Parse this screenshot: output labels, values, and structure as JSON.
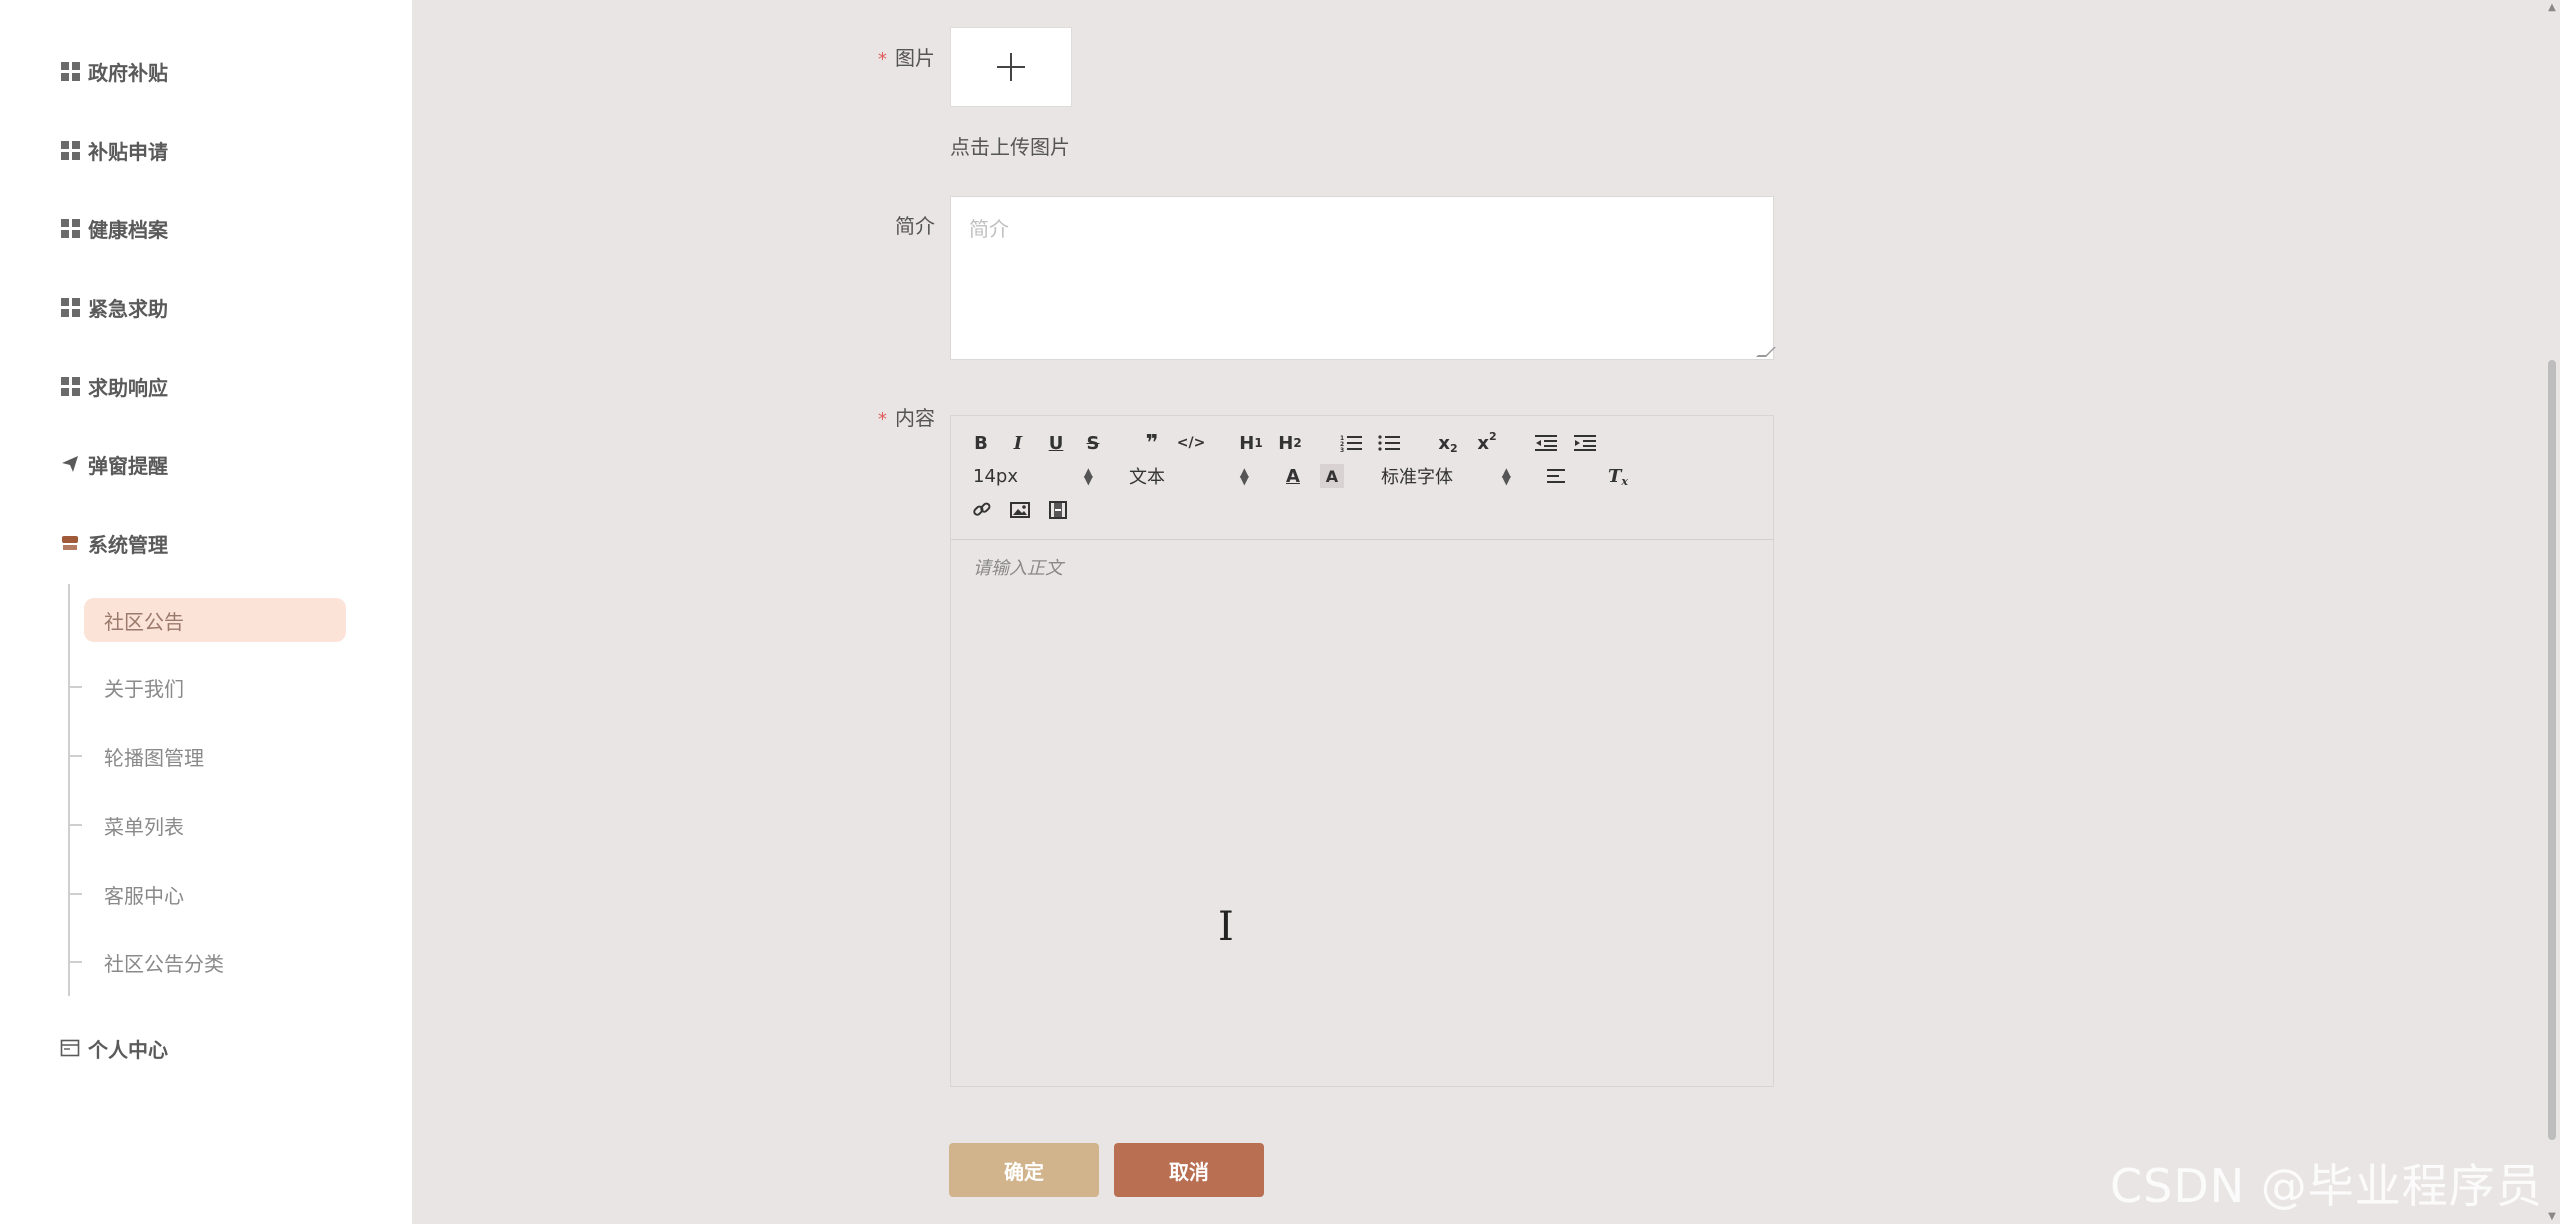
{
  "sidebar": {
    "items": [
      {
        "label": "政府补贴",
        "icon": "grid-icon"
      },
      {
        "label": "补贴申请",
        "icon": "grid-icon"
      },
      {
        "label": "健康档案",
        "icon": "grid-icon"
      },
      {
        "label": "紧急求助",
        "icon": "grid-icon"
      },
      {
        "label": "求助响应",
        "icon": "grid-icon"
      },
      {
        "label": "弹窗提醒",
        "icon": "paper-plane-icon"
      },
      {
        "label": "系统管理",
        "icon": "store-icon"
      },
      {
        "label": "个人中心",
        "icon": "window-icon"
      }
    ],
    "submenu": [
      {
        "label": "社区公告",
        "active": true
      },
      {
        "label": "关于我们",
        "active": false
      },
      {
        "label": "轮播图管理",
        "active": false
      },
      {
        "label": "菜单列表",
        "active": false
      },
      {
        "label": "客服中心",
        "active": false
      },
      {
        "label": "社区公告分类",
        "active": false
      }
    ]
  },
  "form": {
    "image_label": "图片",
    "upload_tip": "点击上传图片",
    "intro_label": "简介",
    "intro_placeholder": "简介",
    "content_label": "内容",
    "required_mark": "*",
    "editor": {
      "font_size": "14px",
      "paragraph": "文本",
      "font_family": "标准字体",
      "placeholder": "请输入正文"
    },
    "ok_button": "确定",
    "cancel_button": "取消"
  },
  "watermark": "CSDN @毕业程序员",
  "colors": {
    "accent_active_bg": "#fbe3d8",
    "ok_button": "#d2b48c",
    "cancel_button": "#b86f52",
    "required": "#e05a5a"
  }
}
